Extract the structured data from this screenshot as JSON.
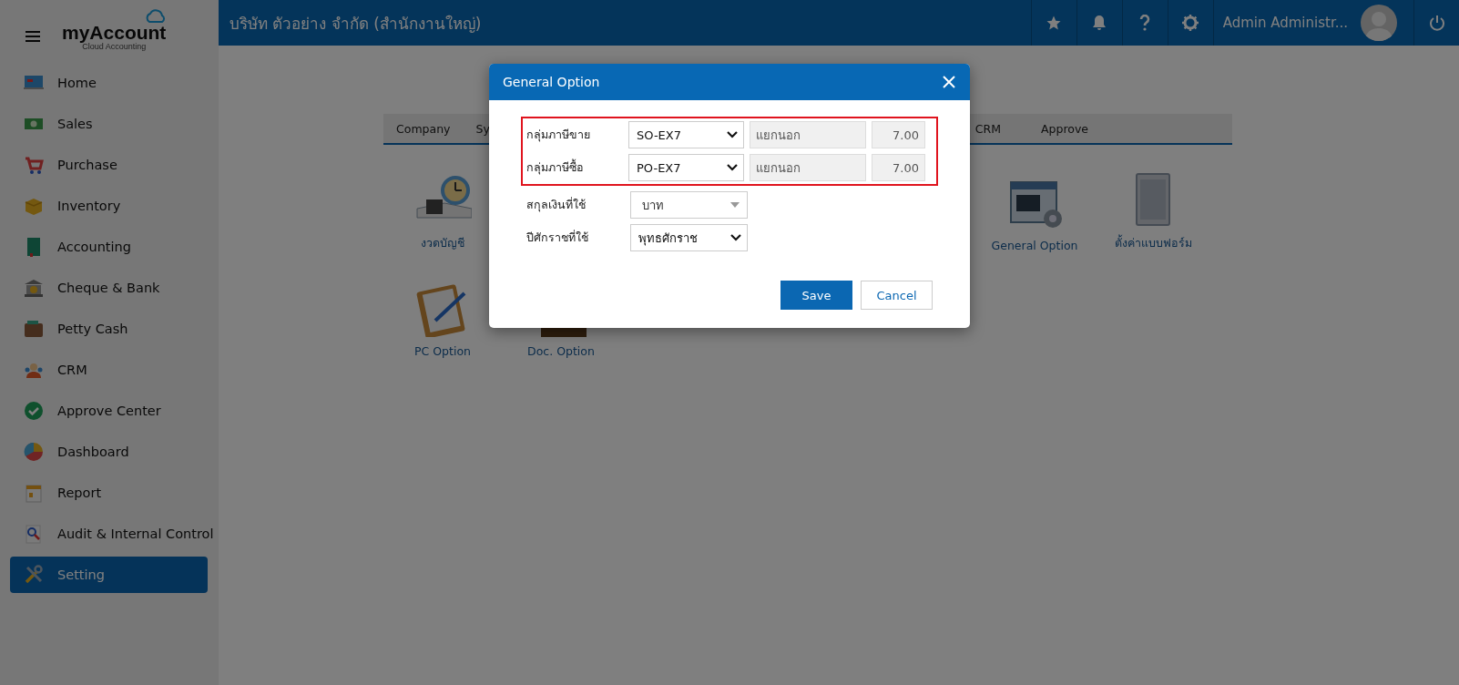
{
  "logo": {
    "name": "myAccount",
    "tagline": "Cloud Accounting"
  },
  "top_bar": {
    "company": "บริษัท ตัวอย่าง จำกัด (สำนักงานใหญ่)",
    "user": "Admin Administr..."
  },
  "sidebar": {
    "items": [
      {
        "label": "Home",
        "kind": "home",
        "selected": false
      },
      {
        "label": "Sales",
        "kind": "sales",
        "selected": false
      },
      {
        "label": "Purchase",
        "kind": "purchase",
        "selected": false
      },
      {
        "label": "Inventory",
        "kind": "inventory",
        "selected": false
      },
      {
        "label": "Accounting",
        "kind": "accounting",
        "selected": false
      },
      {
        "label": "Cheque & Bank",
        "kind": "bank",
        "selected": false
      },
      {
        "label": "Petty Cash",
        "kind": "cash",
        "selected": false
      },
      {
        "label": "CRM",
        "kind": "crm",
        "selected": false
      },
      {
        "label": "Approve Center",
        "kind": "approve",
        "selected": false
      },
      {
        "label": "Dashboard",
        "kind": "dashboard",
        "selected": false
      },
      {
        "label": "Report",
        "kind": "report",
        "selected": false
      },
      {
        "label": "Audit & Internal Control",
        "kind": "audit",
        "selected": false
      },
      {
        "label": "Setting",
        "kind": "setting",
        "selected": true
      }
    ]
  },
  "settings": {
    "tabs_left": [
      "Company",
      "Sy"
    ],
    "tabs_right": [
      "CRM",
      "Approve"
    ],
    "row_1_left": [
      {
        "label": "งวดบัญชี",
        "kind": "period"
      }
    ],
    "row_1_right": [
      {
        "label": "General Option",
        "kind": "window"
      },
      {
        "label": "ตั้งค่าแบบฟอร์ม",
        "kind": "form"
      }
    ],
    "row_2": [
      {
        "label": "PC Option",
        "kind": "clipboard"
      },
      {
        "label": "Doc. Option",
        "kind": "doc"
      }
    ]
  },
  "dialog": {
    "title": "General Option",
    "tax_groups": {
      "highlighted": true,
      "rows": [
        {
          "label": "กลุ่มภาษีขาย",
          "value": "SO-EX7",
          "type": "แยกนอก",
          "rate": "7.00"
        },
        {
          "label": "กลุ่มภาษีซื้อ",
          "value": "PO-EX7",
          "type": "แยกนอก",
          "rate": "7.00"
        }
      ]
    },
    "rows": [
      {
        "label": "สกุลเงินที่ใช้",
        "value": "บาท",
        "kind": "combo"
      },
      {
        "label": "ปีศักราชที่ใช้",
        "value": "พุทธศักราช",
        "kind": "select"
      }
    ],
    "buttons": [
      {
        "label": "Save",
        "kind": "primary"
      },
      {
        "label": "Cancel",
        "kind": "secondary"
      }
    ]
  }
}
